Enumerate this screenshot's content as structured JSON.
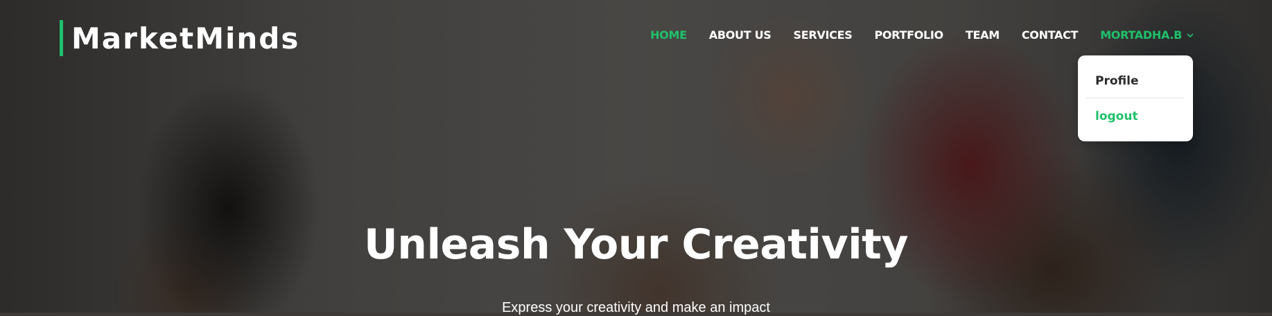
{
  "brand": {
    "name": "MarketMinds",
    "accent_color": "#1fc16b"
  },
  "nav": {
    "items": [
      {
        "label": "HOME",
        "active": true
      },
      {
        "label": "ABOUT US",
        "active": false
      },
      {
        "label": "SERVICES",
        "active": false
      },
      {
        "label": "PORTFOLIO",
        "active": false
      },
      {
        "label": "TEAM",
        "active": false
      },
      {
        "label": "CONTACT",
        "active": false
      }
    ],
    "user_label": "MORTADHA.B",
    "user_icon": "chevron-down-icon"
  },
  "user_menu": {
    "open": true,
    "items": [
      {
        "label": "Profile"
      },
      {
        "label": "logout"
      }
    ]
  },
  "hero": {
    "headline": "Unleash Your Creativity",
    "subtext": "Express your creativity and make an impact"
  }
}
